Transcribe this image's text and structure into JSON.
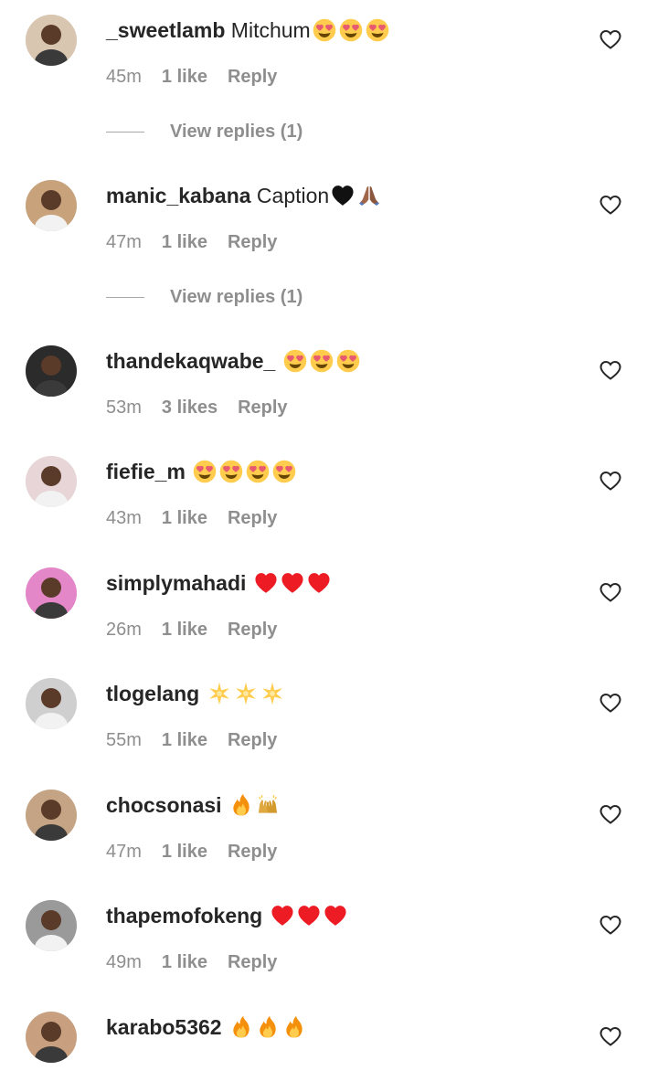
{
  "comments": [
    {
      "username": "_sweetlamb",
      "text": "Mitchum",
      "emoji": [
        "heart-eyes",
        "heart-eyes",
        "heart-eyes"
      ],
      "time": "45m",
      "likes": "1 like",
      "reply": "Reply",
      "view_replies": "View replies (1)",
      "avatar_color": "#d9c6b0"
    },
    {
      "username": "manic_kabana",
      "text": "Caption",
      "emoji": [
        "black-heart",
        "praying-hands"
      ],
      "time": "47m",
      "likes": "1 like",
      "reply": "Reply",
      "view_replies": "View replies (1)",
      "avatar_color": "#c8a27a"
    },
    {
      "username": "thandekaqwabe_",
      "text": "",
      "emoji": [
        "heart-eyes",
        "heart-eyes",
        "heart-eyes"
      ],
      "time": "53m",
      "likes": "3 likes",
      "reply": "Reply",
      "avatar_color": "#2b2b2b"
    },
    {
      "username": "fiefie_m",
      "text": "",
      "emoji": [
        "heart-eyes",
        "heart-eyes",
        "heart-eyes",
        "heart-eyes"
      ],
      "time": "43m",
      "likes": "1 like",
      "reply": "Reply",
      "avatar_color": "#e8d5d8"
    },
    {
      "username": "simplymahadi",
      "text": "",
      "emoji": [
        "red-heart",
        "red-heart",
        "red-heart"
      ],
      "time": "26m",
      "likes": "1 like",
      "reply": "Reply",
      "avatar_color": "#e487c9"
    },
    {
      "username": "tlogelang",
      "text": "",
      "emoji": [
        "sparkle-star",
        "sparkle-star",
        "sparkle-star"
      ],
      "time": "55m",
      "likes": "1 like",
      "reply": "Reply",
      "avatar_color": "#cfcfcf"
    },
    {
      "username": "chocsonasi",
      "text": "",
      "emoji": [
        "fire",
        "raised-hands"
      ],
      "time": "47m",
      "likes": "1 like",
      "reply": "Reply",
      "avatar_color": "#c4a484"
    },
    {
      "username": "thapemofokeng",
      "text": "",
      "emoji": [
        "red-heart",
        "red-heart",
        "red-heart"
      ],
      "time": "49m",
      "likes": "1 like",
      "reply": "Reply",
      "avatar_color": "#9a9a9a"
    },
    {
      "username": "karabo5362",
      "text": "",
      "emoji": [
        "fire",
        "fire",
        "fire"
      ],
      "time": "",
      "likes": "",
      "reply": "",
      "avatar_color": "#c9a07f"
    }
  ],
  "colors": {
    "text_primary": "#262626",
    "text_secondary": "#8e8e8e",
    "heart_red": "#ed1c24",
    "heart_eyes_face": "#ffcc4d"
  }
}
